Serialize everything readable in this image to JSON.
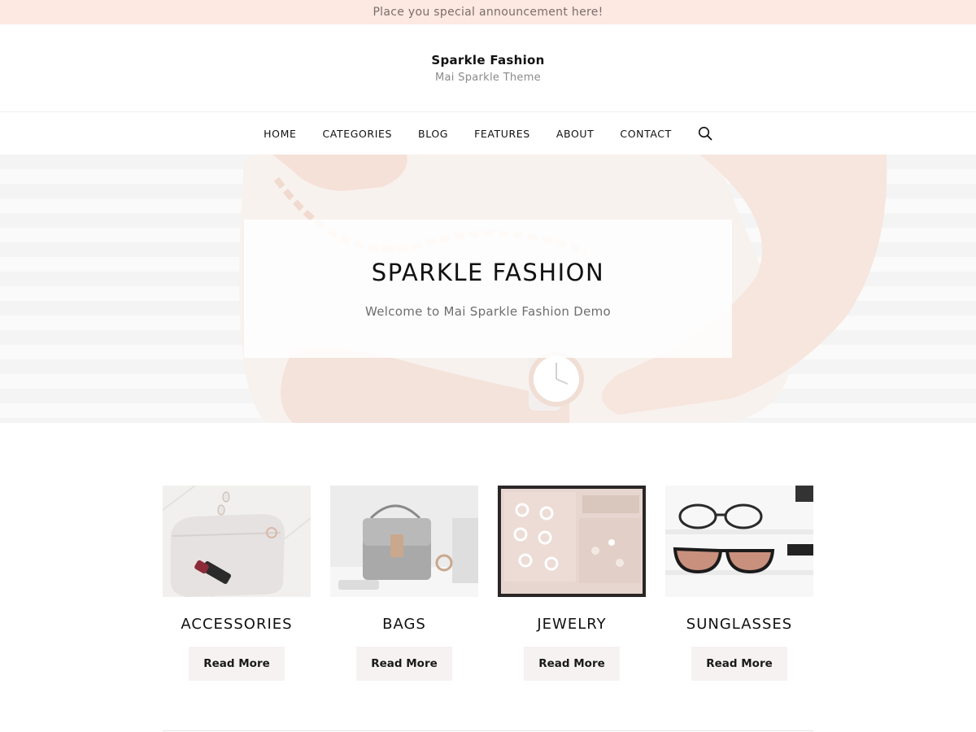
{
  "announcement": {
    "text": "Place you special announcement here!"
  },
  "header": {
    "site_title": "Sparkle Fashion",
    "tagline": "Mai Sparkle Theme"
  },
  "nav": {
    "items": [
      {
        "label": "HOME"
      },
      {
        "label": "CATEGORIES"
      },
      {
        "label": "BLOG"
      },
      {
        "label": "FEATURES"
      },
      {
        "label": "ABOUT"
      },
      {
        "label": "CONTACT"
      }
    ],
    "search_icon": "search-icon"
  },
  "hero": {
    "title": "SPARKLE FASHION",
    "subtitle": "Welcome to Mai Sparkle Fashion Demo"
  },
  "categories": [
    {
      "title": "ACCESSORIES",
      "button": "Read More"
    },
    {
      "title": "BAGS",
      "button": "Read More"
    },
    {
      "title": "JEWELRY",
      "button": "Read More"
    },
    {
      "title": "SUNGLASSES",
      "button": "Read More"
    }
  ],
  "colors": {
    "announcement_bg": "#fde8e2",
    "button_bg": "#f6f2f1",
    "text": "#111111"
  }
}
